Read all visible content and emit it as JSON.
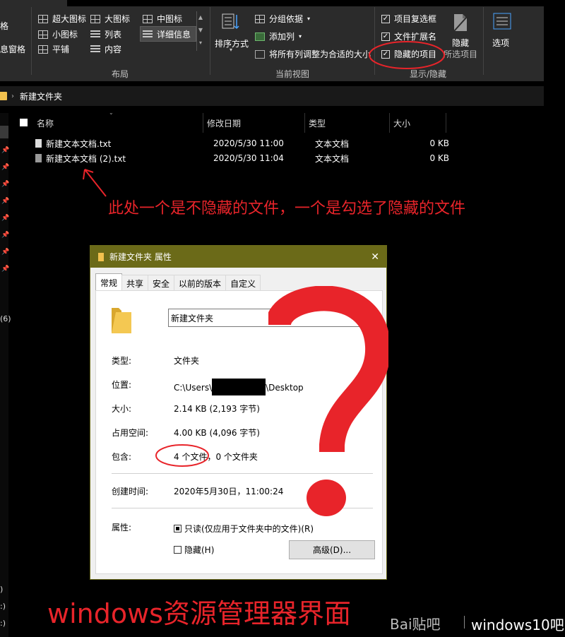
{
  "ribbon": {
    "left_partial": [
      "格",
      "息窗格"
    ],
    "layout_items": [
      "超大图标",
      "大图标",
      "中图标",
      "小图标",
      "列表",
      "详细信息",
      "平铺",
      "内容"
    ],
    "layout_group_label": "布局",
    "sort_label": "排序方式",
    "current_view_items": [
      "分组依据",
      "添加列",
      "将所有列调整为合适的大小"
    ],
    "current_view_group_label": "当前视图",
    "show_hide_items": [
      "项目复选框",
      "文件扩展名",
      "隐藏的项目"
    ],
    "hide_selected_label": [
      "隐藏",
      "所选项目"
    ],
    "show_hide_group_label": "显示/隐藏",
    "options_label": "选项"
  },
  "address": {
    "path": "新建文件夹"
  },
  "file_list": {
    "columns": [
      "名称",
      "修改日期",
      "类型",
      "大小"
    ],
    "rows": [
      {
        "name": "新建文本文档.txt",
        "modified": "2020/5/30 11:00",
        "type": "文本文档",
        "size": "0 KB"
      },
      {
        "name": "新建文本文档 (2).txt",
        "modified": "2020/5/30 11:04",
        "type": "文本文档",
        "size": "0 KB"
      }
    ]
  },
  "nav_partial": [
    "(6)",
    ")",
    ":)",
    ":)"
  ],
  "annotation_top": "此处一个是不隐藏的文件，一个是勾选了隐藏的文件",
  "dialog": {
    "title": "新建文件夹 属性",
    "close_glyph": "✕",
    "tabs": [
      "常规",
      "共享",
      "安全",
      "以前的版本",
      "自定义"
    ],
    "folder_name": "新建文件夹",
    "props": [
      {
        "label": "类型:",
        "value": "文件夹"
      },
      {
        "label": "位置:",
        "value_prefix": "C:\\Users\\",
        "value_suffix": "\\Desktop"
      },
      {
        "label": "大小:",
        "value": "2.14 KB (2,193 字节)"
      },
      {
        "label": "占用空间:",
        "value": "4.00 KB (4,096 字节)"
      },
      {
        "label": "包含:",
        "value_a": "4 个文件",
        "value_b": "，0 个文件夹"
      }
    ],
    "created_label": "创建时间:",
    "created_value": "2020年5月30日，11:00:24",
    "attr_label": "属性:",
    "readonly_label": "只读(仅应用于文件夹中的文件)(R)",
    "hidden_label": "隐藏(H)",
    "advanced_button": "高级(D)..."
  },
  "annotation_bottom": "windows资源管理器界面",
  "watermark": {
    "logo": "Bai贴吧",
    "site": "windows10吧"
  },
  "colors": {
    "annotation_red": "#e8242a",
    "dialog_title_bar": "#6b6a18"
  }
}
